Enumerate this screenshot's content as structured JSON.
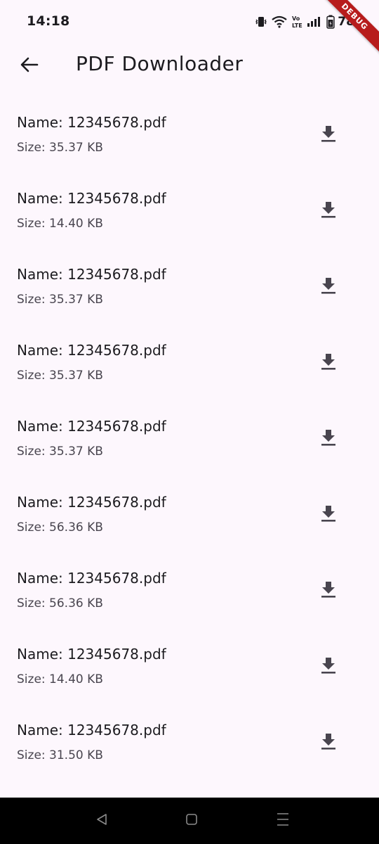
{
  "status_bar": {
    "time": "14:18",
    "battery_percent": "78%",
    "network_label": "Vo LTE",
    "icons": [
      "vibrate-icon",
      "wifi-icon",
      "volte-icon",
      "signal-icon",
      "battery-icon"
    ]
  },
  "debug_banner": {
    "label": "DEBUG",
    "color": "#b71c1c"
  },
  "app_bar": {
    "title": "PDF Downloader",
    "back_icon": "arrow-back-icon"
  },
  "files": [
    {
      "name": "Name: 12345678.pdf",
      "size": "Size: 35.37 KB"
    },
    {
      "name": "Name: 12345678.pdf",
      "size": "Size: 14.40 KB"
    },
    {
      "name": "Name: 12345678.pdf",
      "size": "Size: 35.37 KB"
    },
    {
      "name": "Name: 12345678.pdf",
      "size": "Size: 35.37 KB"
    },
    {
      "name": "Name: 12345678.pdf",
      "size": "Size: 35.37 KB"
    },
    {
      "name": "Name: 12345678.pdf",
      "size": "Size: 56.36 KB"
    },
    {
      "name": "Name: 12345678.pdf",
      "size": "Size: 56.36 KB"
    },
    {
      "name": "Name: 12345678.pdf",
      "size": "Size: 14.40 KB"
    },
    {
      "name": "Name: 12345678.pdf",
      "size": "Size: 31.50 KB"
    }
  ],
  "nav_bar": {
    "buttons": [
      "back-triangle-icon",
      "home-square-icon",
      "recents-menu-icon"
    ]
  },
  "colors": {
    "background": "#fdf7fd",
    "text_primary": "#1c1b1f",
    "text_secondary": "#49454f",
    "icon": "#49454f",
    "nav_bar": "#000000"
  }
}
